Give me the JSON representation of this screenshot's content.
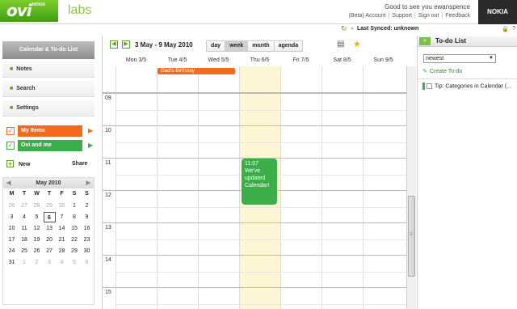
{
  "header": {
    "brand": "ovi",
    "brand_sub": "NOKIA",
    "labs": "labs",
    "greeting": "Good to see you ewanspence",
    "links": [
      "(Beta) Account",
      "Support",
      "Sign out",
      "Feedback"
    ],
    "nokia": "NOKIA"
  },
  "sync": {
    "label": "Last Synced: unknown"
  },
  "sidebar": {
    "title": "Calendar & To-do List",
    "items": [
      "Notes",
      "Search",
      "Settings"
    ],
    "calendars": [
      {
        "name": "My Items",
        "color": "#f26b1d"
      },
      {
        "name": "Ovi and me",
        "color": "#3bae4a"
      }
    ],
    "new_label": "New",
    "share_label": "Share"
  },
  "mini_calendar": {
    "month": "May 2010",
    "dow": [
      "M",
      "T",
      "W",
      "T",
      "F",
      "S",
      "S"
    ],
    "weeks": [
      [
        "26",
        "27",
        "28",
        "29",
        "30",
        "1",
        "2"
      ],
      [
        "3",
        "4",
        "5",
        "6",
        "7",
        "8",
        "9"
      ],
      [
        "10",
        "11",
        "12",
        "13",
        "14",
        "15",
        "16"
      ],
      [
        "17",
        "18",
        "19",
        "20",
        "21",
        "22",
        "23"
      ],
      [
        "24",
        "25",
        "26",
        "27",
        "28",
        "29",
        "30"
      ],
      [
        "31",
        "1",
        "2",
        "3",
        "4",
        "5",
        "6"
      ]
    ],
    "today": "6"
  },
  "toolbar": {
    "range": "3 May - 9 May 2010",
    "views": [
      "day",
      "week",
      "month",
      "agenda"
    ],
    "active_view": "week"
  },
  "week": {
    "days": [
      "Mon 3/5",
      "Tue 4/5",
      "Wed 5/5",
      "Thu 6/5",
      "Fri 7/5",
      "Sat 8/5",
      "Sun 9/5"
    ],
    "today_index": 3,
    "hours": [
      "09",
      "10",
      "11",
      "12",
      "13",
      "14",
      "15"
    ],
    "allday_event": {
      "title": "Dad's Birthday",
      "color": "#f26b1d"
    },
    "event": {
      "time": "11:07",
      "text": "We've updated Calendar!",
      "color": "#3bae4a"
    }
  },
  "todo": {
    "title": "To-do List",
    "sort": "newest",
    "create": "Create To-do",
    "items": [
      "Tip: Categories in Calendar (..."
    ]
  }
}
